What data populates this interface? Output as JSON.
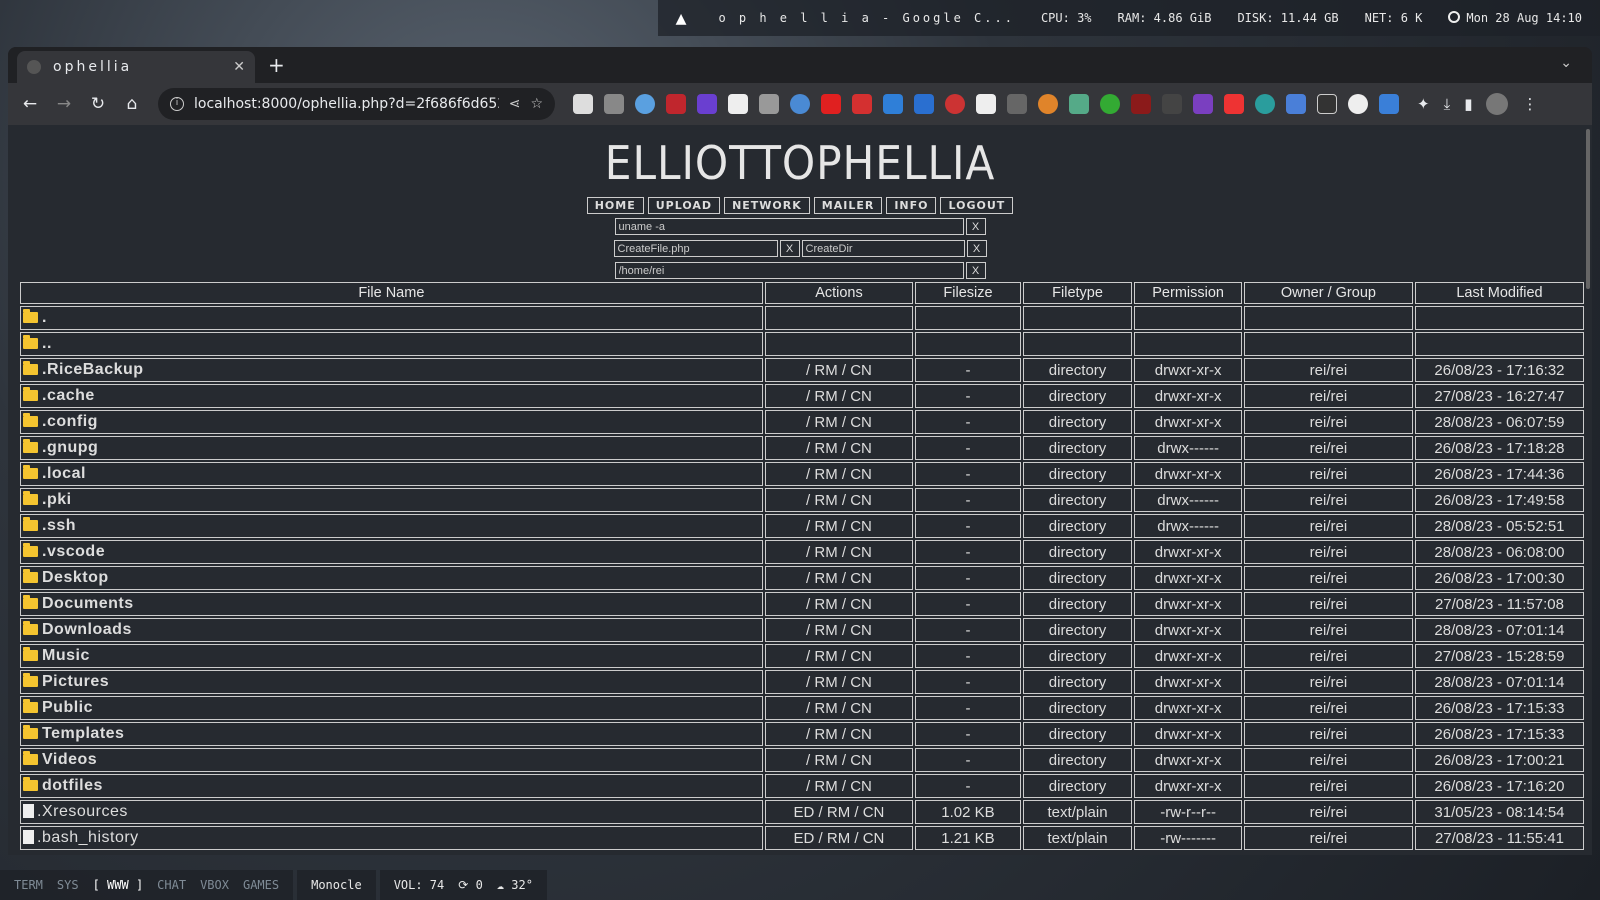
{
  "topbar": {
    "window_title": "o p h e l l i a - Google C...",
    "cpu": "CPU: 3%",
    "ram": "RAM: 4.86 GiB",
    "disk": "DISK: 11.44 GB",
    "net": "NET: 6 K",
    "clock": "Mon 28 Aug 14:10"
  },
  "browser": {
    "tab_title": "ophellia",
    "url": "localhost:8000/ophellia.php?d=2f686f6d652f...",
    "new_tab": "+"
  },
  "page": {
    "title": "ELLIOTTOPHELLIA",
    "nav": [
      "HOME",
      "UPLOAD",
      "NETWORK",
      "MAILER",
      "INFO",
      "LOGOUT"
    ],
    "cmd_value": "uname -a",
    "create_file_value": "CreateFile.php",
    "create_dir_value": "CreateDir",
    "path_value": "/home/rei",
    "x_label": "X"
  },
  "table": {
    "headers": [
      "File Name",
      "Actions",
      "Filesize",
      "Filetype",
      "Permission",
      "Owner / Group",
      "Last Modified"
    ],
    "rows": [
      {
        "name": ".",
        "type": "dir",
        "actions": "",
        "size": "",
        "filetype": "",
        "perm": "",
        "owner": "",
        "modified": ""
      },
      {
        "name": "..",
        "type": "dir",
        "actions": "",
        "size": "",
        "filetype": "",
        "perm": "",
        "owner": "",
        "modified": ""
      },
      {
        "name": ".RiceBackup",
        "type": "dir",
        "actions": "/ RM / CN",
        "size": "-",
        "filetype": "directory",
        "perm": "drwxr-xr-x",
        "owner": "rei/rei",
        "modified": "26/08/23 - 17:16:32"
      },
      {
        "name": ".cache",
        "type": "dir",
        "actions": "/ RM / CN",
        "size": "-",
        "filetype": "directory",
        "perm": "drwxr-xr-x",
        "owner": "rei/rei",
        "modified": "27/08/23 - 16:27:47"
      },
      {
        "name": ".config",
        "type": "dir",
        "actions": "/ RM / CN",
        "size": "-",
        "filetype": "directory",
        "perm": "drwxr-xr-x",
        "owner": "rei/rei",
        "modified": "28/08/23 - 06:07:59"
      },
      {
        "name": ".gnupg",
        "type": "dir",
        "actions": "/ RM / CN",
        "size": "-",
        "filetype": "directory",
        "perm": "drwx------",
        "owner": "rei/rei",
        "modified": "26/08/23 - 17:18:28"
      },
      {
        "name": ".local",
        "type": "dir",
        "actions": "/ RM / CN",
        "size": "-",
        "filetype": "directory",
        "perm": "drwxr-xr-x",
        "owner": "rei/rei",
        "modified": "26/08/23 - 17:44:36"
      },
      {
        "name": ".pki",
        "type": "dir",
        "actions": "/ RM / CN",
        "size": "-",
        "filetype": "directory",
        "perm": "drwx------",
        "owner": "rei/rei",
        "modified": "26/08/23 - 17:49:58"
      },
      {
        "name": ".ssh",
        "type": "dir",
        "actions": "/ RM / CN",
        "size": "-",
        "filetype": "directory",
        "perm": "drwx------",
        "owner": "rei/rei",
        "modified": "28/08/23 - 05:52:51"
      },
      {
        "name": ".vscode",
        "type": "dir",
        "actions": "/ RM / CN",
        "size": "-",
        "filetype": "directory",
        "perm": "drwxr-xr-x",
        "owner": "rei/rei",
        "modified": "28/08/23 - 06:08:00"
      },
      {
        "name": "Desktop",
        "type": "dir",
        "actions": "/ RM / CN",
        "size": "-",
        "filetype": "directory",
        "perm": "drwxr-xr-x",
        "owner": "rei/rei",
        "modified": "26/08/23 - 17:00:30"
      },
      {
        "name": "Documents",
        "type": "dir",
        "actions": "/ RM / CN",
        "size": "-",
        "filetype": "directory",
        "perm": "drwxr-xr-x",
        "owner": "rei/rei",
        "modified": "27/08/23 - 11:57:08"
      },
      {
        "name": "Downloads",
        "type": "dir",
        "actions": "/ RM / CN",
        "size": "-",
        "filetype": "directory",
        "perm": "drwxr-xr-x",
        "owner": "rei/rei",
        "modified": "28/08/23 - 07:01:14"
      },
      {
        "name": "Music",
        "type": "dir",
        "actions": "/ RM / CN",
        "size": "-",
        "filetype": "directory",
        "perm": "drwxr-xr-x",
        "owner": "rei/rei",
        "modified": "27/08/23 - 15:28:59"
      },
      {
        "name": "Pictures",
        "type": "dir",
        "actions": "/ RM / CN",
        "size": "-",
        "filetype": "directory",
        "perm": "drwxr-xr-x",
        "owner": "rei/rei",
        "modified": "28/08/23 - 07:01:14"
      },
      {
        "name": "Public",
        "type": "dir",
        "actions": "/ RM / CN",
        "size": "-",
        "filetype": "directory",
        "perm": "drwxr-xr-x",
        "owner": "rei/rei",
        "modified": "26/08/23 - 17:15:33"
      },
      {
        "name": "Templates",
        "type": "dir",
        "actions": "/ RM / CN",
        "size": "-",
        "filetype": "directory",
        "perm": "drwxr-xr-x",
        "owner": "rei/rei",
        "modified": "26/08/23 - 17:15:33"
      },
      {
        "name": "Videos",
        "type": "dir",
        "actions": "/ RM / CN",
        "size": "-",
        "filetype": "directory",
        "perm": "drwxr-xr-x",
        "owner": "rei/rei",
        "modified": "26/08/23 - 17:00:21"
      },
      {
        "name": "dotfiles",
        "type": "dir",
        "actions": "/ RM / CN",
        "size": "-",
        "filetype": "directory",
        "perm": "drwxr-xr-x",
        "owner": "rei/rei",
        "modified": "26/08/23 - 17:16:20"
      },
      {
        "name": ".Xresources",
        "type": "file",
        "actions": "ED / RM / CN",
        "size": "1.02 KB",
        "filetype": "text/plain",
        "perm": "-rw-r--r--",
        "owner": "rei/rei",
        "modified": "31/05/23 - 08:14:54"
      },
      {
        "name": ".bash_history",
        "type": "file",
        "actions": "ED / RM / CN",
        "size": "1.21 KB",
        "filetype": "text/plain",
        "perm": "-rw-------",
        "owner": "rei/rei",
        "modified": "27/08/23 - 11:55:41"
      }
    ]
  },
  "bottombar": {
    "workspaces": [
      "TERM",
      "SYS",
      "[ WWW ]",
      "CHAT",
      "VBOX",
      "GAMES"
    ],
    "active_workspace": "[ WWW ]",
    "layout": "Monocle",
    "volume": "VOL: 74",
    "updates": "0",
    "weather": "32°"
  }
}
